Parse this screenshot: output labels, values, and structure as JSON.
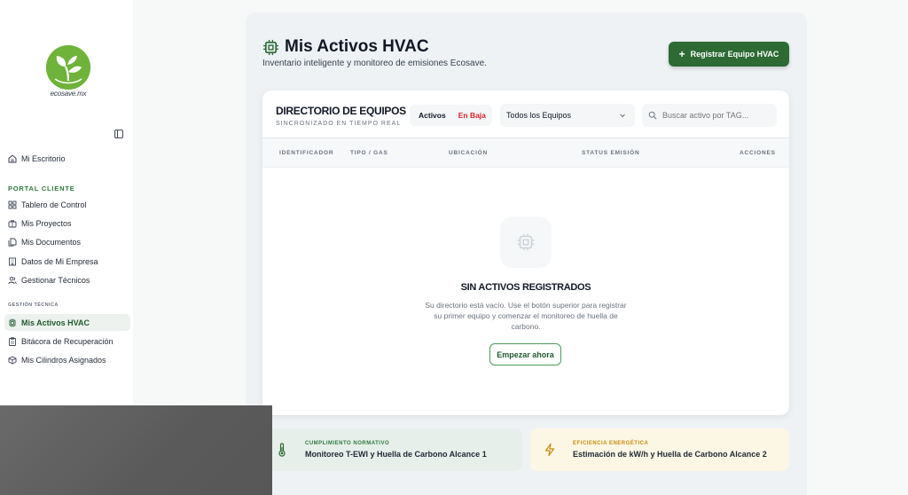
{
  "brand": {
    "logo_text": "ecosave.mx"
  },
  "sidebar": {
    "items": [
      {
        "label": "Mi Escritorio"
      }
    ],
    "section_portal": "PORTAL CLIENTE",
    "portal_items": [
      {
        "label": "Tablero de Control"
      },
      {
        "label": "Mis Proyectos"
      },
      {
        "label": "Mis Documentos"
      },
      {
        "label": "Datos de Mi Empresa"
      },
      {
        "label": "Gestionar Técnicos"
      }
    ],
    "section_tecnica": "GESTIÓN TÉCNICA",
    "tecnica_items": [
      {
        "label": "Mis Activos HVAC"
      },
      {
        "label": "Bitácora de Recuperación"
      },
      {
        "label": "Mis Cilindros Asignados"
      }
    ]
  },
  "header": {
    "title": "Mis Activos HVAC",
    "subtitle": "Inventario inteligente y monitoreo de emisiones Ecosave.",
    "primary_button": "Registrar Equipo HVAC"
  },
  "directory": {
    "title": "DIRECTORIO DE EQUIPOS",
    "subtitle": "SINCRONIZADO EN TIEMPO REAL",
    "toggle": {
      "active": "Activos",
      "inactive": "En Baja"
    },
    "filter": {
      "selected": "Todos los Equipos"
    },
    "search": {
      "placeholder": "Buscar activo por TAG..."
    },
    "columns": [
      "IDENTIFICADOR",
      "TIPO / GAS",
      "UBICACIÓN",
      "STATUS EMISIÓN",
      "ACCIONES"
    ],
    "empty": {
      "title": "SIN ACTIVOS REGISTRADOS",
      "description": "Su directorio está vacío. Use el botón superior para registrar su primer equipo y comenzar el monitoreo de huella de carbono.",
      "button": "Empezar ahora"
    }
  },
  "info_cards": [
    {
      "label": "CUMPLIMIENTO NORMATIVO",
      "text": "Monitoreo T-EWI y Huella de Carbono Alcance 1",
      "icon": "thermometer-icon"
    },
    {
      "label": "EFICIENCIA ENERGÉTICA",
      "text": "Estimación de kW/h y Huella de Carbono Alcance 2",
      "icon": "lightning-icon"
    }
  ],
  "colors": {
    "primary": "#2d6a34",
    "accent_green": "#2f7a3d",
    "danger": "#dc2626",
    "warning": "#c98a0c"
  }
}
